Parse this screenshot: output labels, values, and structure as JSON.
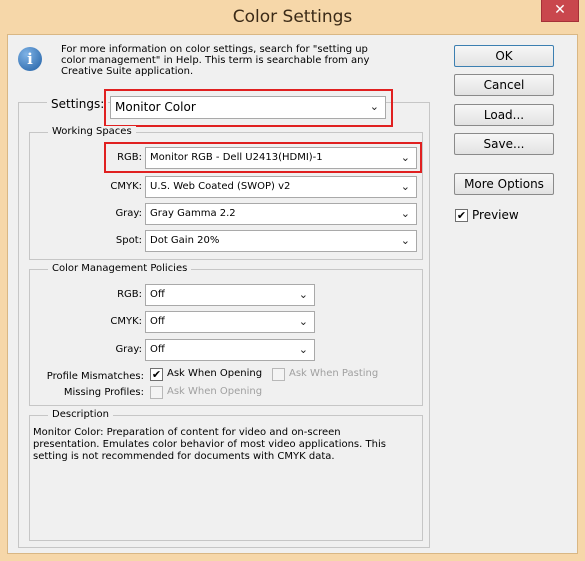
{
  "window": {
    "title": "Color Settings",
    "close_glyph": "✕"
  },
  "info": {
    "icon": "i",
    "text": "For more information on color settings, search for \"setting up color management\" in Help. This term is searchable from any Creative Suite application."
  },
  "buttons": {
    "ok": "OK",
    "cancel": "Cancel",
    "load": "Load...",
    "save": "Save...",
    "more_options": "More Options"
  },
  "preview": {
    "label": "Preview",
    "checked": true
  },
  "settings": {
    "label": "Settings:",
    "value": "Monitor Color"
  },
  "working_spaces": {
    "legend": "Working Spaces",
    "rgb": {
      "label": "RGB:",
      "value": "Monitor RGB - Dell U2413(HDMI)-1"
    },
    "cmyk": {
      "label": "CMYK:",
      "value": "U.S. Web Coated (SWOP) v2"
    },
    "gray": {
      "label": "Gray:",
      "value": "Gray Gamma 2.2"
    },
    "spot": {
      "label": "Spot:",
      "value": "Dot Gain 20%"
    }
  },
  "policies": {
    "legend": "Color Management Policies",
    "rgb": {
      "label": "RGB:",
      "value": "Off"
    },
    "cmyk": {
      "label": "CMYK:",
      "value": "Off"
    },
    "gray": {
      "label": "Gray:",
      "value": "Off"
    },
    "profile_mismatches": {
      "label": "Profile Mismatches:",
      "ask_opening": "Ask When Opening",
      "ask_pasting": "Ask When Pasting"
    },
    "missing_profiles": {
      "label": "Missing Profiles:",
      "ask_opening": "Ask When Opening"
    }
  },
  "description": {
    "legend": "Description",
    "text": "Monitor Color:  Preparation of content for video and on-screen presentation. Emulates color behavior of most video applications. This setting is not recommended for documents with CMYK data."
  },
  "colors": {
    "title_bar": "#f6d7a9",
    "close_button": "#c9474d",
    "highlight": "#e02020"
  },
  "icons": {
    "dropdown": "chevron-down-icon",
    "info": "info-icon",
    "check": "✔"
  }
}
